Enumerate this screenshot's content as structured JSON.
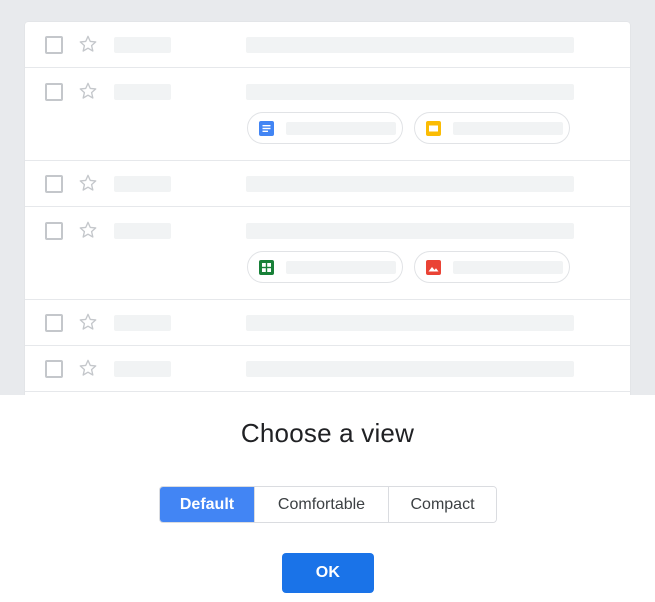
{
  "dialog": {
    "title": "Choose a view",
    "options": [
      {
        "label": "Default",
        "selected": true
      },
      {
        "label": "Comfortable",
        "selected": false
      },
      {
        "label": "Compact",
        "selected": false
      }
    ],
    "ok_label": "OK"
  },
  "preview": {
    "rows": [
      {
        "type": "single"
      },
      {
        "type": "with-attachments",
        "attachments": [
          "docs-icon",
          "slides-icon"
        ]
      },
      {
        "type": "single"
      },
      {
        "type": "with-attachments",
        "attachments": [
          "sheets-icon",
          "image-icon"
        ]
      },
      {
        "type": "single"
      },
      {
        "type": "single"
      }
    ]
  },
  "colors": {
    "accent": "#4285f4",
    "ok_button": "#1a73e8",
    "docs": "#4285f4",
    "slides": "#fbbc04",
    "sheets": "#188038",
    "image": "#ea4335"
  }
}
